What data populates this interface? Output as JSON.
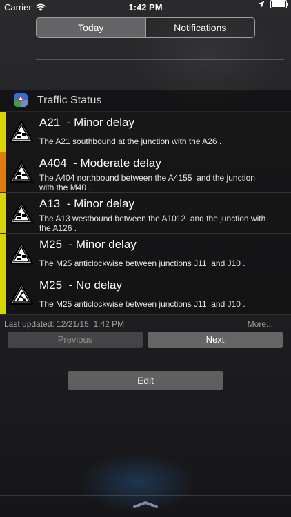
{
  "status_bar": {
    "carrier": "Carrier",
    "time": "1:42 PM"
  },
  "segments": {
    "today": "Today",
    "notifications": "Notifications"
  },
  "widget": {
    "title": "Traffic Status"
  },
  "colors": {
    "minor": "#d9d500",
    "moderate": "#e07b12",
    "none": "#d9d500"
  },
  "rows": [
    {
      "road": "A21",
      "status": "  - Minor delay",
      "desc": "The A21 southbound at the junction with the A26 .",
      "severity": "minor",
      "icon": "traffic-jam-icon"
    },
    {
      "road": "A404",
      "status": "  - Moderate delay",
      "desc": "The A404 northbound between the A4155  and the junction\nwith the M40 .",
      "severity": "moderate",
      "icon": "traffic-jam-icon"
    },
    {
      "road": "A13",
      "status": "  - Minor delay",
      "desc": "The A13 westbound between the A1012  and the junction with\nthe A126 .",
      "severity": "minor",
      "icon": "traffic-jam-icon"
    },
    {
      "road": "M25",
      "status": "  - Minor delay",
      "desc": "The M25 anticlockwise between junctions J11  and J10 .",
      "severity": "minor",
      "icon": "traffic-jam-icon"
    },
    {
      "road": "M25",
      "status": "  - No delay",
      "desc": "The M25 anticlockwise between junctions J11  and J10 .",
      "severity": "none",
      "icon": "roadworks-icon"
    }
  ],
  "footer": {
    "last_updated": "Last updated: 12/21/15, 1:42 PM",
    "more": "More..."
  },
  "pager": {
    "previous": "Previous",
    "next": "Next"
  },
  "edit": "Edit"
}
